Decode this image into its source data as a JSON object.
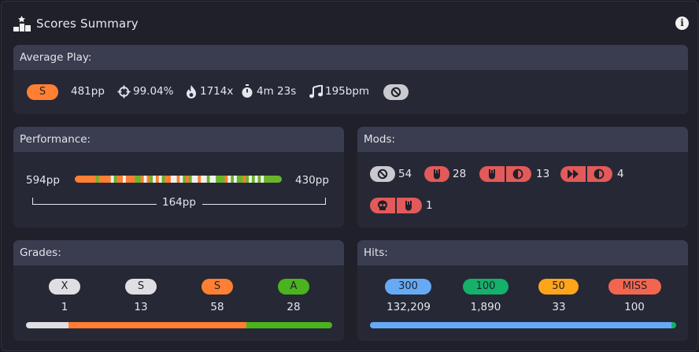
{
  "header": {
    "title": "Scores Summary",
    "podium_icon": "podium-icon",
    "info_icon": "info-icon",
    "info_glyph": "i"
  },
  "average_play": {
    "label": "Average Play:",
    "grade": "S",
    "pp": "481pp",
    "accuracy": "99.04%",
    "combo": "1714x",
    "length": "4m 23s",
    "bpm": "195bpm",
    "mod_icon": "no-mod-icon"
  },
  "performance": {
    "label": "Performance:",
    "max": "594pp",
    "min": "430pp",
    "range": "164pp",
    "colors": {
      "orange": "#ff7f33",
      "green": "#6ab42a",
      "white": "#f0f0f0"
    }
  },
  "mods": {
    "label": "Mods:",
    "entries": [
      {
        "icons": [
          "no-mod-icon"
        ],
        "count": "54"
      },
      {
        "icons": [
          "hard-rock-icon"
        ],
        "count": "28"
      },
      {
        "icons": [
          "hard-rock-icon",
          "hidden-icon"
        ],
        "count": "13"
      },
      {
        "icons": [
          "double-time-icon",
          "hidden-icon"
        ],
        "count": "4"
      },
      {
        "icons": [
          "sudden-death-icon",
          "hard-rock-icon"
        ],
        "count": "1"
      }
    ]
  },
  "grades": {
    "label": "Grades:",
    "items": [
      {
        "grade": "X",
        "count": "1",
        "color": "#dfdfe3",
        "text_color": "#1f2029"
      },
      {
        "grade": "S",
        "count": "13",
        "color": "#dfdfe3",
        "text_color": "#1f2029"
      },
      {
        "grade": "S",
        "count": "58",
        "color": "#ff7f33",
        "text_color": "#1f2029"
      },
      {
        "grade": "A",
        "count": "28",
        "color": "#4bb31e",
        "text_color": "#1f2029"
      }
    ],
    "bar_fractions": [
      0.0,
      0.14,
      0.58,
      0.28
    ]
  },
  "hits": {
    "label": "Hits:",
    "items": [
      {
        "label": "300",
        "count": "132,209",
        "color": "#66aaf5"
      },
      {
        "label": "100",
        "count": "1,890",
        "color": "#15b06a"
      },
      {
        "label": "50",
        "count": "33",
        "color": "#ffa51a"
      },
      {
        "label": "MISS",
        "count": "100",
        "color": "#f2664f"
      }
    ],
    "bar_fractions": [
      0.985,
      0.014,
      0.0002,
      0.0008
    ]
  }
}
